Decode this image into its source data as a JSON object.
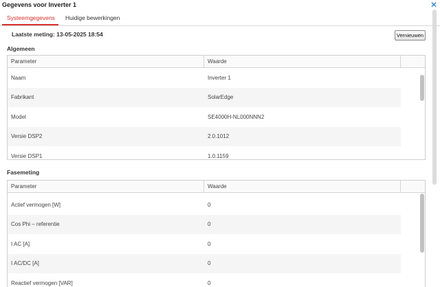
{
  "window": {
    "title": "Gegevens voor Inverter 1",
    "close_symbol": "✕"
  },
  "tabs": [
    {
      "label": "Systeemgegevens",
      "active": true
    },
    {
      "label": "Huidige bewerkingen",
      "active": false
    }
  ],
  "measurement": {
    "text": "Laatste meting: 13-05-2025 18:54"
  },
  "refresh_button": {
    "label": "Vernieuwen"
  },
  "general": {
    "title": "Algemeen",
    "columns": [
      "Parameter",
      "Waarde"
    ],
    "rows": [
      {
        "param": "Naam",
        "value": "Inverter 1"
      },
      {
        "param": "Fabrikant",
        "value": "SolarEdge"
      },
      {
        "param": "Model",
        "value": "SE4000H-NL000NNN2"
      },
      {
        "param": "Versie DSP2",
        "value": "2.0.1012"
      },
      {
        "param": "Versie DSP1",
        "value": "1.0.1159"
      }
    ]
  },
  "phase": {
    "title": "Fasemeting",
    "columns": [
      "Parameter",
      "Waarde"
    ],
    "rows": [
      {
        "param": "Actief vermogen [W]",
        "value": "0"
      },
      {
        "param": "Cos Phi – referentie",
        "value": "0"
      },
      {
        "param": "I AC [A]",
        "value": "0"
      },
      {
        "param": "I AC/DC [A]",
        "value": "0"
      },
      {
        "param": "Reactief vermogen [VAR]",
        "value": "0"
      }
    ]
  },
  "colors": {
    "accent": "#d9302b",
    "close": "#1e73be"
  }
}
